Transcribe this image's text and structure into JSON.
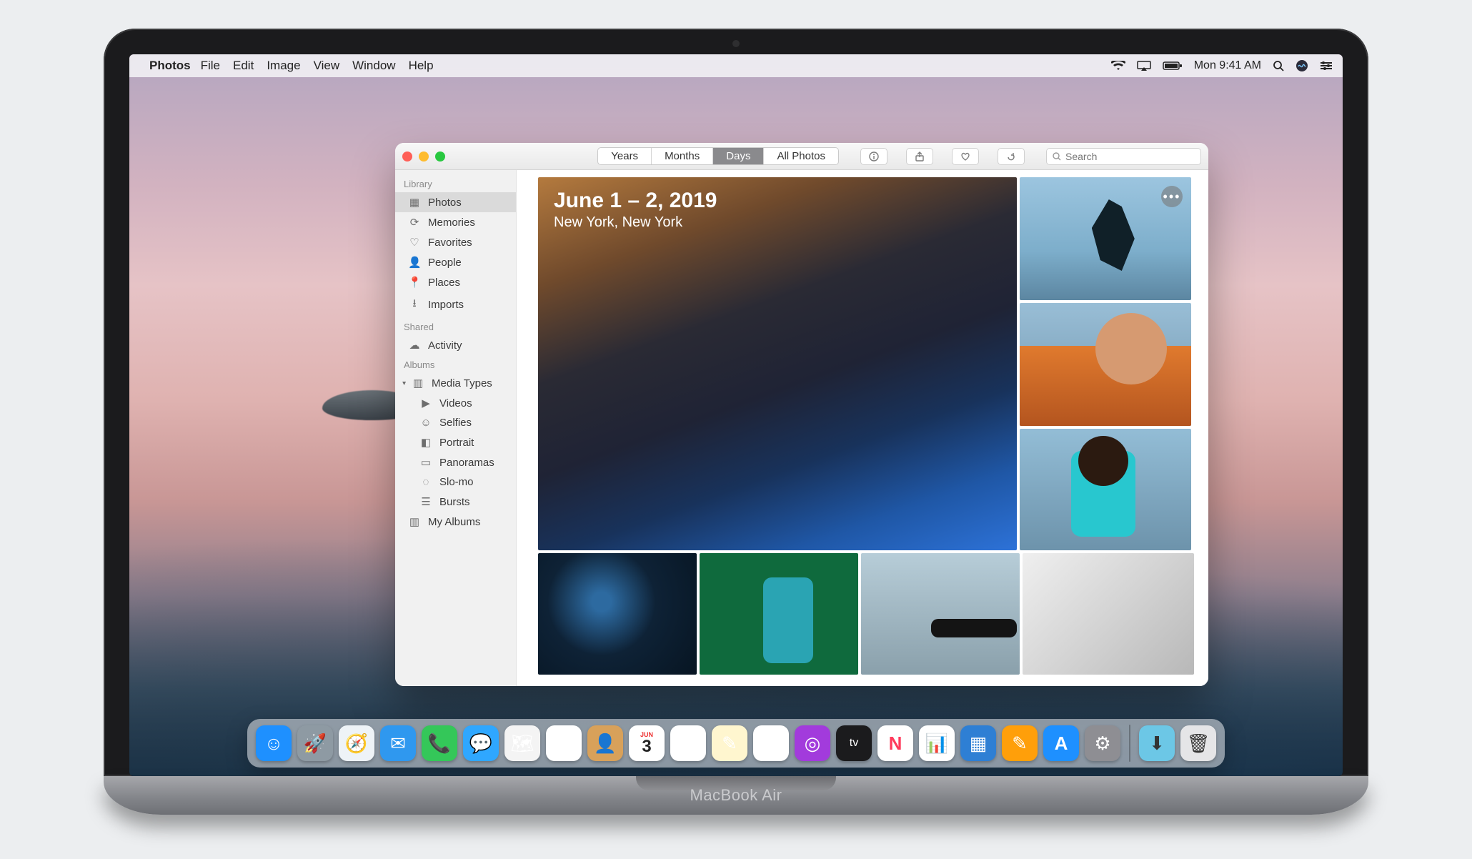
{
  "device_label": "MacBook Air",
  "menubar": {
    "app": "Photos",
    "items": [
      "File",
      "Edit",
      "Image",
      "View",
      "Window",
      "Help"
    ],
    "clock": "Mon 9:41 AM"
  },
  "window": {
    "segments": {
      "years": "Years",
      "months": "Months",
      "days": "Days",
      "all": "All Photos",
      "active": "days"
    },
    "search_placeholder": "Search",
    "hero": {
      "title": "June 1 – 2, 2019",
      "subtitle": "New York, New York"
    }
  },
  "sidebar": {
    "sections": {
      "library": {
        "label": "Library",
        "items": [
          {
            "icon": "photos-icon",
            "label": "Photos",
            "selected": true
          },
          {
            "icon": "memories-icon",
            "label": "Memories"
          },
          {
            "icon": "heart-icon",
            "label": "Favorites"
          },
          {
            "icon": "person-icon",
            "label": "People"
          },
          {
            "icon": "pin-icon",
            "label": "Places"
          },
          {
            "icon": "download-icon",
            "label": "Imports"
          }
        ]
      },
      "shared": {
        "label": "Shared",
        "items": [
          {
            "icon": "cloud-icon",
            "label": "Activity"
          }
        ]
      },
      "albums": {
        "label": "Albums",
        "media_types_label": "Media Types",
        "media_types": [
          {
            "icon": "video-icon",
            "label": "Videos"
          },
          {
            "icon": "selfie-icon",
            "label": "Selfies"
          },
          {
            "icon": "cube-icon",
            "label": "Portrait"
          },
          {
            "icon": "pano-icon",
            "label": "Panoramas"
          },
          {
            "icon": "slomo-icon",
            "label": "Slo-mo"
          },
          {
            "icon": "burst-icon",
            "label": "Bursts"
          }
        ],
        "my_albums_label": "My Albums"
      }
    }
  },
  "dock": {
    "apps": [
      {
        "name": "finder",
        "bg": "#1e90ff",
        "glyph": "☺"
      },
      {
        "name": "launchpad",
        "bg": "#8e9aa3",
        "glyph": "🚀"
      },
      {
        "name": "safari",
        "bg": "#eef3f7",
        "glyph": "🧭"
      },
      {
        "name": "mail",
        "bg": "#2f98ef",
        "glyph": "✉"
      },
      {
        "name": "facetime",
        "bg": "#34c759",
        "glyph": "📞"
      },
      {
        "name": "messages",
        "bg": "#2fa7ff",
        "glyph": "💬"
      },
      {
        "name": "maps",
        "bg": "#f4f4f4",
        "glyph": "🗺"
      },
      {
        "name": "photos",
        "bg": "#ffffff",
        "glyph": "✿"
      },
      {
        "name": "contacts",
        "bg": "#d8a15a",
        "glyph": "👤"
      },
      {
        "name": "calendar",
        "bg": "#ffffff",
        "glyph": "3"
      },
      {
        "name": "reminders",
        "bg": "#ffffff",
        "glyph": "☰"
      },
      {
        "name": "notes",
        "bg": "#fff6cf",
        "glyph": "✎"
      },
      {
        "name": "music",
        "bg": "#ffffff",
        "glyph": "♪"
      },
      {
        "name": "podcasts",
        "bg": "#a23bdc",
        "glyph": "◎"
      },
      {
        "name": "tv",
        "bg": "#1b1b1d",
        "glyph": "tv"
      },
      {
        "name": "news",
        "bg": "#ffffff",
        "glyph": "N"
      },
      {
        "name": "numbers",
        "bg": "#ffffff",
        "glyph": "📊"
      },
      {
        "name": "keynote",
        "bg": "#2e7fd4",
        "glyph": "▦"
      },
      {
        "name": "pages",
        "bg": "#ff9f0a",
        "glyph": "✎"
      },
      {
        "name": "appstore",
        "bg": "#1e90ff",
        "glyph": "A"
      },
      {
        "name": "settings",
        "bg": "#8e8e93",
        "glyph": "⚙"
      }
    ],
    "right": [
      {
        "name": "downloads",
        "bg": "#6cc7e6",
        "glyph": "⬇"
      },
      {
        "name": "trash",
        "bg": "#e5e5e7",
        "glyph": "🗑"
      }
    ]
  }
}
